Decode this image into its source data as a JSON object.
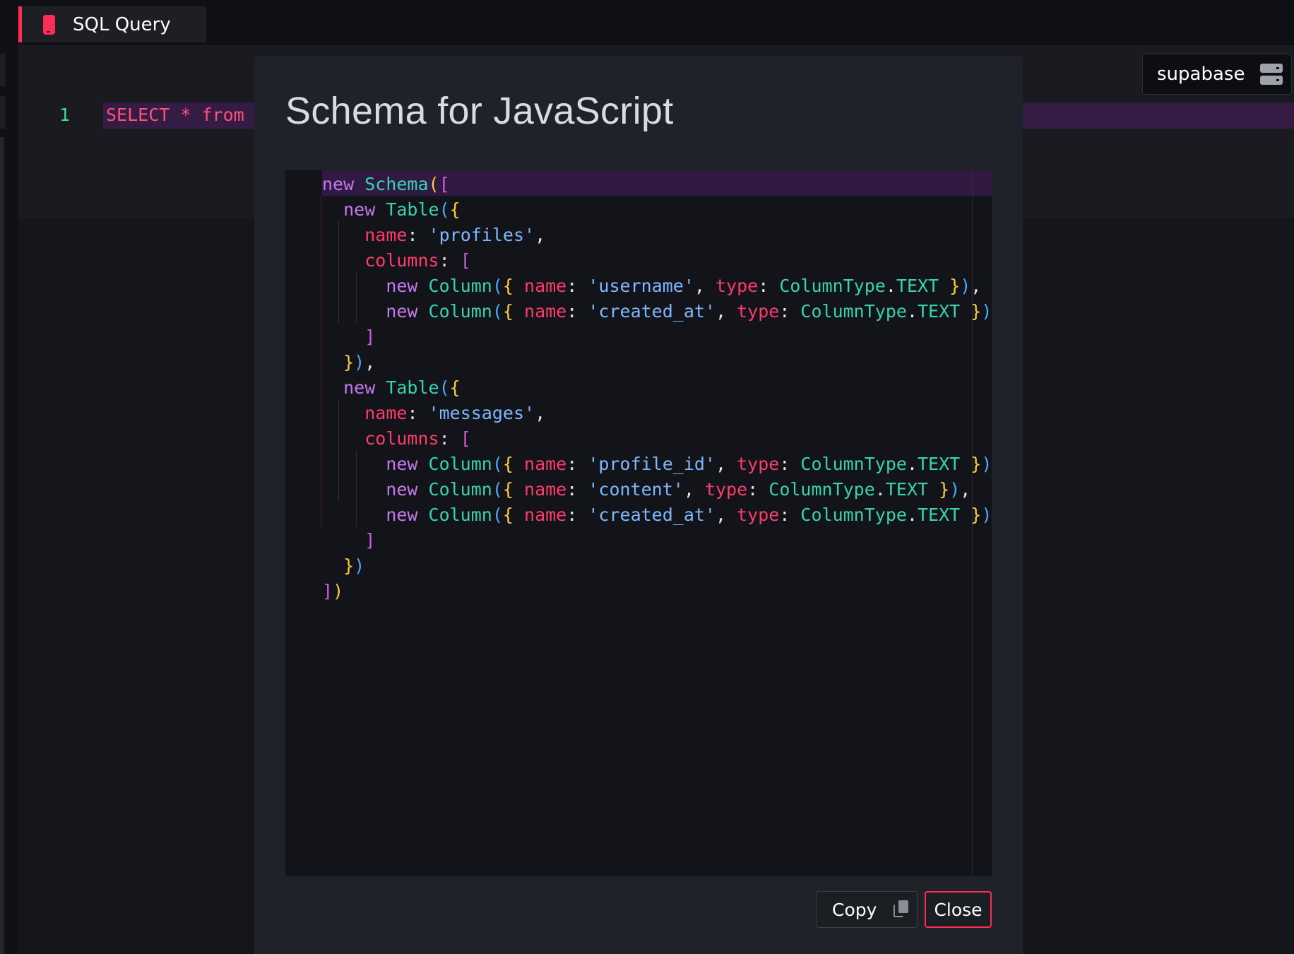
{
  "tab": {
    "title": "SQL Query"
  },
  "editor": {
    "line_number": "1",
    "query_visible": "SELECT * from m"
  },
  "connection": {
    "label": "supabase"
  },
  "modal": {
    "title": "Schema for JavaScript",
    "code_lines": [
      "new Schema([",
      "  new Table({",
      "    name: 'profiles',",
      "    columns: [",
      "      new Column({ name: 'username', type: ColumnType.TEXT }),",
      "      new Column({ name: 'created_at', type: ColumnType.TEXT })",
      "    ]",
      "  }),",
      "  new Table({",
      "    name: 'messages',",
      "    columns: [",
      "      new Column({ name: 'profile_id', type: ColumnType.TEXT }),",
      "      new Column({ name: 'content', type: ColumnType.TEXT }),",
      "      new Column({ name: 'created_at', type: ColumnType.TEXT })",
      "    ]",
      "  })",
      "])"
    ],
    "copy_label": "Copy",
    "close_label": "Close"
  },
  "colors": {
    "accent": "#ff2d55",
    "modal_bg": "#1f2329",
    "code_bg": "#12141a",
    "keyword": "#c678f0",
    "class_name": "#37d3b0",
    "property": "#ff3b6b",
    "string": "#7fb7ff",
    "brace": "#ffcd3c"
  },
  "icons": {
    "tab_icon": "database-icon",
    "connection_icon": "server-icon",
    "copy_icon": "copy-icon"
  }
}
